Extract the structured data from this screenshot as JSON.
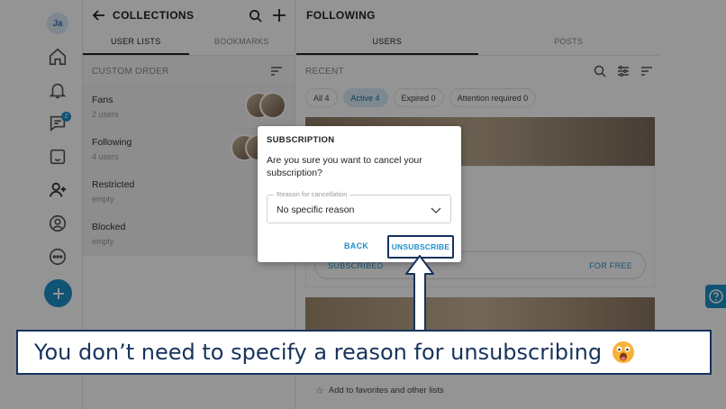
{
  "rail": {
    "avatar_initials": "Ja",
    "messages_badge": "2"
  },
  "collections": {
    "title": "COLLECTIONS",
    "tabs": [
      {
        "label": "USER LISTS",
        "active": true
      },
      {
        "label": "BOOKMARKS",
        "active": false
      }
    ],
    "subheader": "CUSTOM ORDER",
    "items": [
      {
        "name": "Fans",
        "count": "2 users"
      },
      {
        "name": "Following",
        "count": "4 users"
      },
      {
        "name": "Restricted",
        "count": "empty"
      },
      {
        "name": "Blocked",
        "count": "empty"
      }
    ]
  },
  "following": {
    "title": "FOLLOWING",
    "tabs": [
      {
        "label": "USERS",
        "active": true
      },
      {
        "label": "POSTS",
        "active": false
      }
    ],
    "subheader": "RECENT",
    "chips": [
      {
        "label": "All 4",
        "active": false
      },
      {
        "label": "Active 4",
        "active": true
      },
      {
        "label": "Expired 0",
        "active": false
      },
      {
        "label": "Attention required 0",
        "active": false
      }
    ],
    "subscribed_label": "SUBSCRIBED",
    "price_label": "FOR FREE",
    "favorites_label": "Add to favorites and other lists"
  },
  "dialog": {
    "title": "SUBSCRIPTION",
    "message": "Are you sure you want to cancel your subscription?",
    "reason_label": "Reason for cancellation",
    "reason_value": "No specific reason",
    "back_label": "BACK",
    "unsubscribe_label": "UNSUBSCRIBE"
  },
  "caption": {
    "text": "You don’t need to specify a reason for unsubscribing"
  },
  "colors": {
    "accent": "#1e90c8",
    "highlight_border": "#17335c"
  }
}
